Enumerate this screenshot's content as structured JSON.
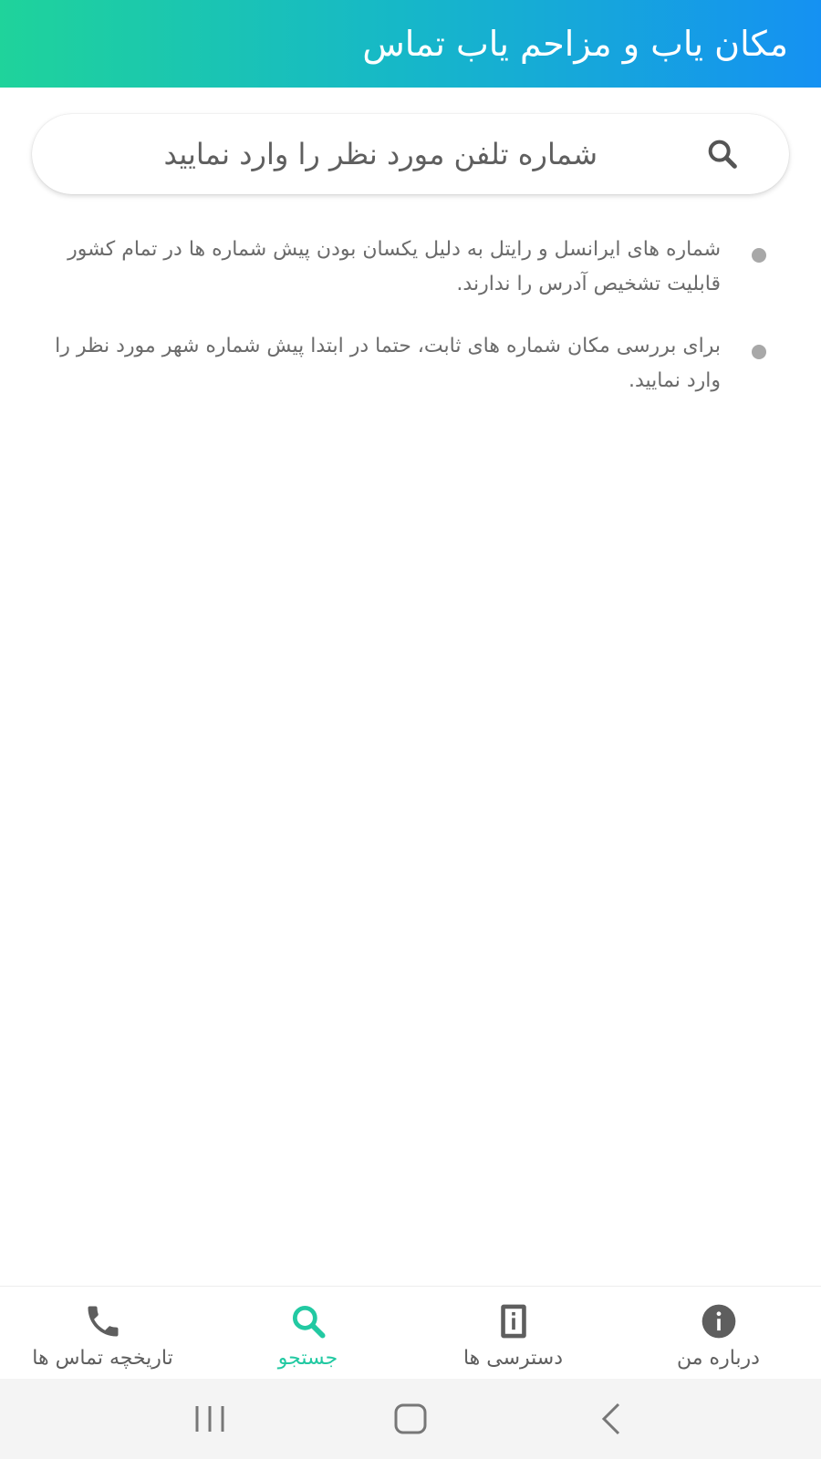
{
  "header": {
    "title": "مکان یاب و مزاحم یاب تماس"
  },
  "search": {
    "placeholder": "شماره تلفن مورد نظر را وارد نمایید",
    "icon": "search-icon"
  },
  "info": {
    "items": [
      "شماره های ایرانسل و رایتل به دلیل یکسان بودن پیش شماره ها در تمام کشور قابلیت تشخیص آدرس را ندارند.",
      "برای بررسی مکان شماره های ثابت، حتما در ابتدا پیش شماره شهر مورد نظر را وارد نمایید."
    ]
  },
  "bottom_nav": {
    "items": [
      {
        "label": "تاریخچه تماس ها",
        "icon": "phone-icon",
        "active": false
      },
      {
        "label": "جستجو",
        "icon": "search-icon",
        "active": true
      },
      {
        "label": "دسترسی ها",
        "icon": "permissions-icon",
        "active": false
      },
      {
        "label": "درباره من",
        "icon": "info-icon",
        "active": false
      }
    ]
  },
  "colors": {
    "header_gradient_start": "#1fd39b",
    "header_gradient_end": "#1591f2",
    "active_nav": "#22c9a2",
    "icon_gray": "#5e5e5e"
  },
  "system_nav": {
    "buttons": [
      "recent-apps-icon",
      "home-icon",
      "back-icon"
    ]
  }
}
